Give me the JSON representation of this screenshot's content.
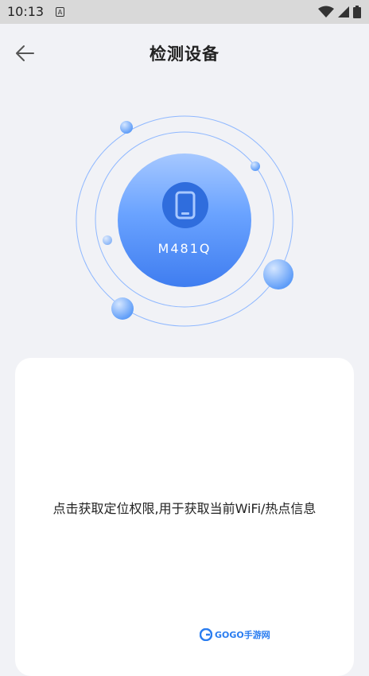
{
  "status_bar": {
    "time": "10:13",
    "notification_letter": "A",
    "icons": [
      "wifi-icon",
      "signal-icon",
      "battery-icon"
    ]
  },
  "header": {
    "title": "检测设备",
    "back_icon": "arrow-left-icon"
  },
  "device": {
    "model": "M481Q",
    "icon": "phone-icon"
  },
  "card": {
    "hint": "点击获取定位权限,用于获取当前WiFi/热点信息"
  },
  "watermark": {
    "text": "GOGO手游网"
  },
  "colors": {
    "accent": "#4a8cf7",
    "background": "#f1f2f6",
    "card": "#ffffff"
  }
}
